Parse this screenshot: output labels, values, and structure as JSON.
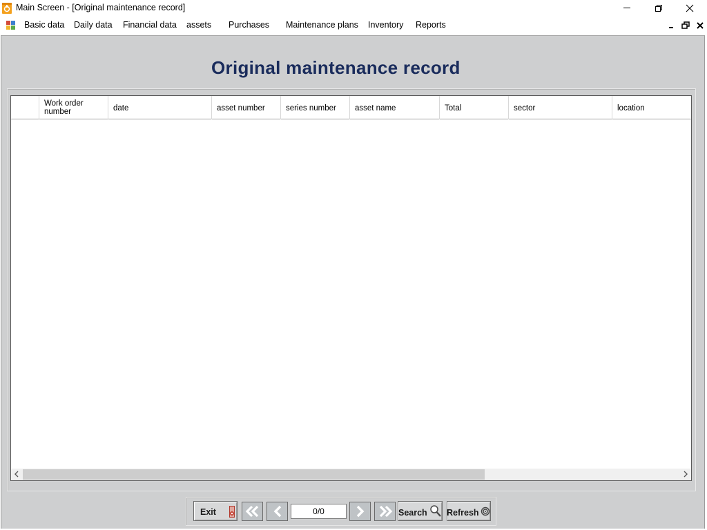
{
  "window": {
    "title": "Main Screen - [Original maintenance record]"
  },
  "menu": {
    "items": [
      "Basic data",
      "Daily data",
      "Financial data",
      "assets",
      "Purchases",
      "Maintenance plans",
      "Inventory",
      "Reports"
    ]
  },
  "page": {
    "heading": "Original maintenance record"
  },
  "table": {
    "columns": [
      "",
      "Work order number",
      "date",
      "asset number",
      "series number",
      "asset name",
      "Total",
      "sector",
      "location"
    ],
    "rows": []
  },
  "toolbar": {
    "exit_label": "Exit",
    "record_counter": "0/0",
    "search_label": "Search",
    "refresh_label": "Refresh"
  },
  "colors": {
    "heading": "#1a2c5c",
    "client_background": "#cecfd0",
    "button_face": "#d7d8d9",
    "nav_button_face": "#bfc3c6",
    "exit_icon": "#b33a2e"
  }
}
